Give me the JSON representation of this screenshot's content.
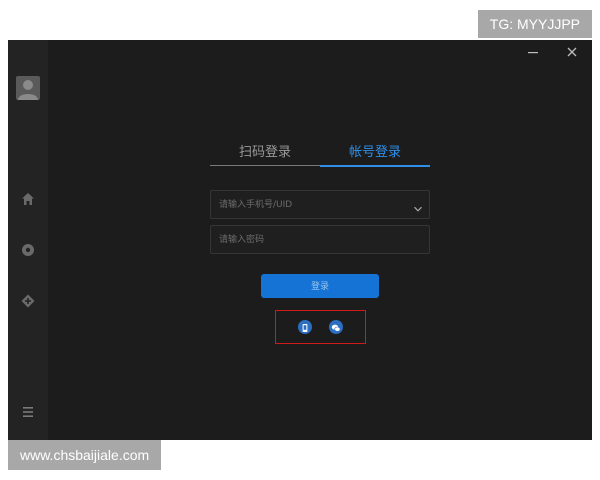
{
  "overlays": {
    "tg_label": "TG: MYYJJPP",
    "site_label": "www.chsbaijiale.com"
  },
  "window_controls": {
    "minimize": "minimize-icon",
    "close": "close-icon"
  },
  "sidebar": {
    "items": [
      {
        "icon": "avatar-icon"
      },
      {
        "icon": "home-icon"
      },
      {
        "icon": "compass-icon"
      },
      {
        "icon": "add-plugin-icon"
      },
      {
        "icon": "menu-icon"
      }
    ]
  },
  "login": {
    "tabs": [
      {
        "label": "扫码登录",
        "active": false
      },
      {
        "label": "帐号登录",
        "active": true
      }
    ],
    "account_field": {
      "placeholder": "请输入手机号/UID",
      "value": ""
    },
    "password_field": {
      "placeholder": "请输入密码",
      "value": ""
    },
    "submit_label": "登录",
    "alt_login": [
      {
        "icon": "phone-icon"
      },
      {
        "icon": "wechat-icon"
      }
    ]
  },
  "colors": {
    "accent": "#2f8ee8",
    "button": "#1473d4",
    "highlight_box": "#d01a1a",
    "background": "#1c1c1c"
  }
}
